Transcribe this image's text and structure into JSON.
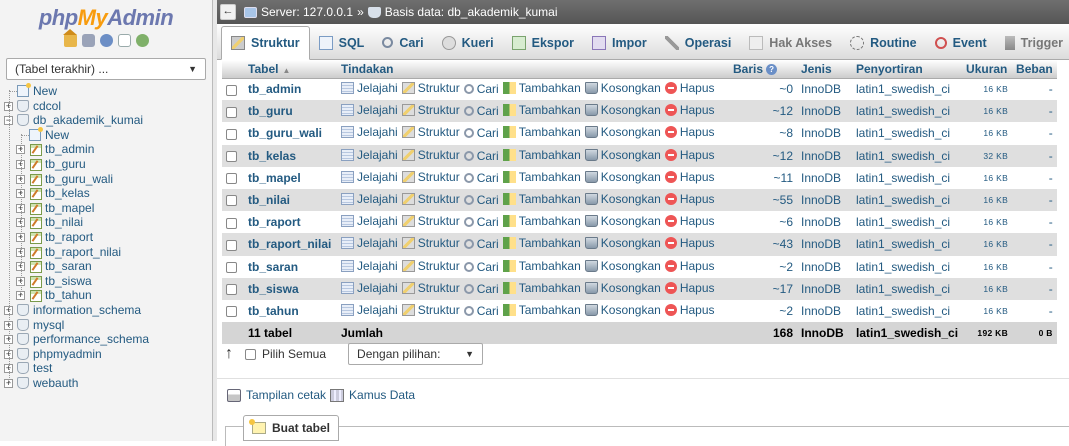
{
  "logo": {
    "php": "php",
    "my": "My",
    "admin": "Admin"
  },
  "nav": {
    "recent_label": "(Tabel terakhir) ...",
    "tree": [
      {
        "label": "New",
        "level": 0,
        "kind": "new"
      },
      {
        "label": "cdcol",
        "level": 0,
        "kind": "db"
      },
      {
        "label": "db_akademik_kumai",
        "level": 0,
        "kind": "db-open"
      },
      {
        "label": "New",
        "level": 1,
        "kind": "new"
      },
      {
        "label": "tb_admin",
        "level": 1,
        "kind": "table"
      },
      {
        "label": "tb_guru",
        "level": 1,
        "kind": "table"
      },
      {
        "label": "tb_guru_wali",
        "level": 1,
        "kind": "table"
      },
      {
        "label": "tb_kelas",
        "level": 1,
        "kind": "table"
      },
      {
        "label": "tb_mapel",
        "level": 1,
        "kind": "table"
      },
      {
        "label": "tb_nilai",
        "level": 1,
        "kind": "table"
      },
      {
        "label": "tb_raport",
        "level": 1,
        "kind": "table"
      },
      {
        "label": "tb_raport_nilai",
        "level": 1,
        "kind": "table"
      },
      {
        "label": "tb_saran",
        "level": 1,
        "kind": "table"
      },
      {
        "label": "tb_siswa",
        "level": 1,
        "kind": "table"
      },
      {
        "label": "tb_tahun",
        "level": 1,
        "kind": "table"
      },
      {
        "label": "information_schema",
        "level": 0,
        "kind": "db"
      },
      {
        "label": "mysql",
        "level": 0,
        "kind": "db"
      },
      {
        "label": "performance_schema",
        "level": 0,
        "kind": "db"
      },
      {
        "label": "phpmyadmin",
        "level": 0,
        "kind": "db"
      },
      {
        "label": "test",
        "level": 0,
        "kind": "db"
      },
      {
        "label": "webauth",
        "level": 0,
        "kind": "db"
      }
    ]
  },
  "topbar": {
    "collapse": "←",
    "server": "Server: 127.0.0.1",
    "separator": "»",
    "database": "Basis data: db_akademik_kumai"
  },
  "tabs": [
    {
      "label": "Struktur",
      "icon": "structure-icon",
      "active": true
    },
    {
      "label": "SQL",
      "icon": "sql-icon"
    },
    {
      "label": "Cari",
      "icon": "search-icon"
    },
    {
      "label": "Kueri",
      "icon": "query-icon"
    },
    {
      "label": "Ekspor",
      "icon": "export-icon"
    },
    {
      "label": "Impor",
      "icon": "import-icon"
    },
    {
      "label": "Operasi",
      "icon": "wrench-icon"
    },
    {
      "label": "Hak Akses",
      "icon": "privileges-icon",
      "muted": true
    },
    {
      "label": "Routine",
      "icon": "routine-icon"
    },
    {
      "label": "Event",
      "icon": "clock-icon"
    },
    {
      "label": "Trigger",
      "icon": "trigger-icon",
      "muted": true
    }
  ],
  "table": {
    "headers": {
      "tabel": "Tabel",
      "tindakan": "Tindakan",
      "baris": "Baris",
      "jenis": "Jenis",
      "penyortiran": "Penyortiran",
      "ukuran": "Ukuran",
      "beban": "Beban"
    },
    "actions": [
      "Jelajahi",
      "Struktur",
      "Cari",
      "Tambahkan",
      "Kosongkan",
      "Hapus"
    ],
    "rows": [
      {
        "name": "tb_admin",
        "rows": "~0",
        "type": "InnoDB",
        "collation": "latin1_swedish_ci",
        "size": "16 KB",
        "overhead": "-"
      },
      {
        "name": "tb_guru",
        "rows": "~12",
        "type": "InnoDB",
        "collation": "latin1_swedish_ci",
        "size": "16 KB",
        "overhead": "-"
      },
      {
        "name": "tb_guru_wali",
        "rows": "~8",
        "type": "InnoDB",
        "collation": "latin1_swedish_ci",
        "size": "16 KB",
        "overhead": "-"
      },
      {
        "name": "tb_kelas",
        "rows": "~12",
        "type": "InnoDB",
        "collation": "latin1_swedish_ci",
        "size": "32 KB",
        "overhead": "-"
      },
      {
        "name": "tb_mapel",
        "rows": "~11",
        "type": "InnoDB",
        "collation": "latin1_swedish_ci",
        "size": "16 KB",
        "overhead": "-"
      },
      {
        "name": "tb_nilai",
        "rows": "~55",
        "type": "InnoDB",
        "collation": "latin1_swedish_ci",
        "size": "16 KB",
        "overhead": "-"
      },
      {
        "name": "tb_raport",
        "rows": "~6",
        "type": "InnoDB",
        "collation": "latin1_swedish_ci",
        "size": "16 KB",
        "overhead": "-"
      },
      {
        "name": "tb_raport_nilai",
        "rows": "~43",
        "type": "InnoDB",
        "collation": "latin1_swedish_ci",
        "size": "16 KB",
        "overhead": "-"
      },
      {
        "name": "tb_saran",
        "rows": "~2",
        "type": "InnoDB",
        "collation": "latin1_swedish_ci",
        "size": "16 KB",
        "overhead": "-"
      },
      {
        "name": "tb_siswa",
        "rows": "~17",
        "type": "InnoDB",
        "collation": "latin1_swedish_ci",
        "size": "16 KB",
        "overhead": "-"
      },
      {
        "name": "tb_tahun",
        "rows": "~2",
        "type": "InnoDB",
        "collation": "latin1_swedish_ci",
        "size": "16 KB",
        "overhead": "-"
      }
    ],
    "total": {
      "count": "11 tabel",
      "label": "Jumlah",
      "rows": "168",
      "type": "InnoDB",
      "collation": "latin1_swedish_ci",
      "size": "192 KB",
      "overhead": "0 B"
    }
  },
  "bottom": {
    "check_all": "Pilih Semua",
    "with_selected": "Dengan pilihan:",
    "print_view": "Tampilan cetak",
    "data_dictionary": "Kamus Data",
    "create_table": "Buat tabel"
  },
  "colors": {
    "link": "#235a81",
    "topbar": "#5f5f5f",
    "row_alt": "#dfdfdf",
    "logo_my": "#f89c0e",
    "logo_php": "#6c78af"
  }
}
